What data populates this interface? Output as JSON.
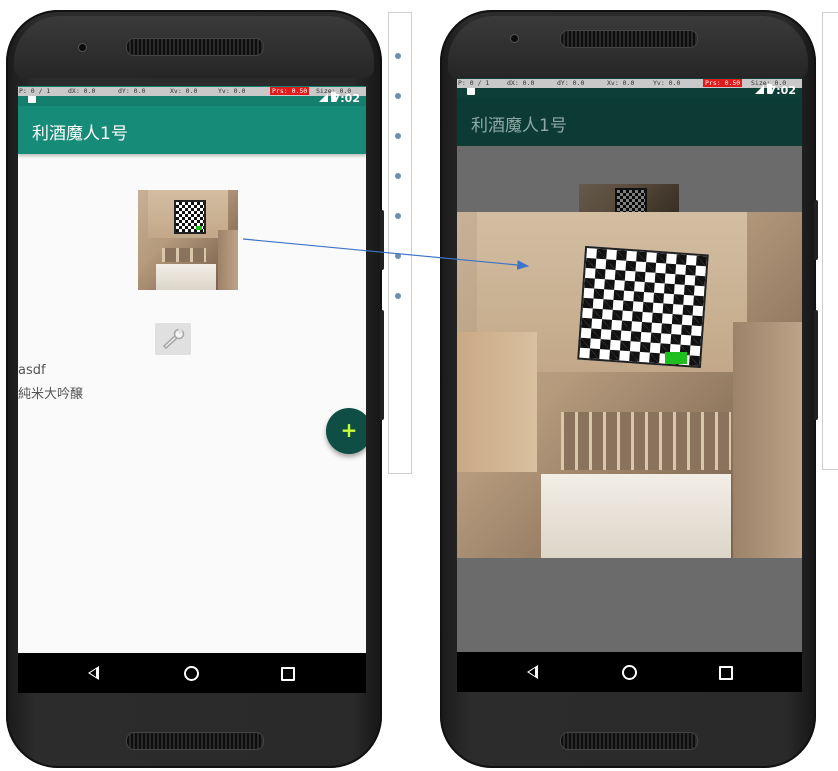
{
  "left_phone": {
    "debug_bar": {
      "p": "P: 0 / 1",
      "dx": "dX: 0.0",
      "dy": "dY: 0.0",
      "xv": "Xv: 0.0",
      "yv": "Yv: 0.0",
      "prs": "Prs: 0.50",
      "size": "Size: 0.0"
    },
    "clock": "7:02",
    "app_title": "利酒魔人1号",
    "list_item": {
      "line1": "asdf",
      "line2": "純米大吟醸"
    },
    "fab_label": "+",
    "thumbnail_icon": "room-photo-thumbnail",
    "wrench_icon": "wrench-icon",
    "nav": {
      "back": "back-icon",
      "home": "home-icon",
      "recents": "recents-icon"
    }
  },
  "right_phone": {
    "debug_bar": {
      "p": "P: 0 / 1",
      "dx": "dX: 0.0",
      "dy": "dY: 0.0",
      "xv": "Xv: 0.0",
      "yv": "Yv: 0.0",
      "prs": "Prs: 0.50",
      "size": "Size: 0.0"
    },
    "clock": "7:02",
    "app_title": "利酒魔人1号",
    "enlarged_image": "room-photo-enlarged",
    "nav": {
      "back": "back-icon",
      "home": "home-icon",
      "recents": "recents-icon"
    }
  },
  "colors": {
    "app_bar": "#168b78",
    "status_bar": "#157f6e",
    "fab": "#0e4e45",
    "fab_plus": "#c6ff3a",
    "arrow": "#3d73c9",
    "pressure_badge": "#e01b1b"
  }
}
